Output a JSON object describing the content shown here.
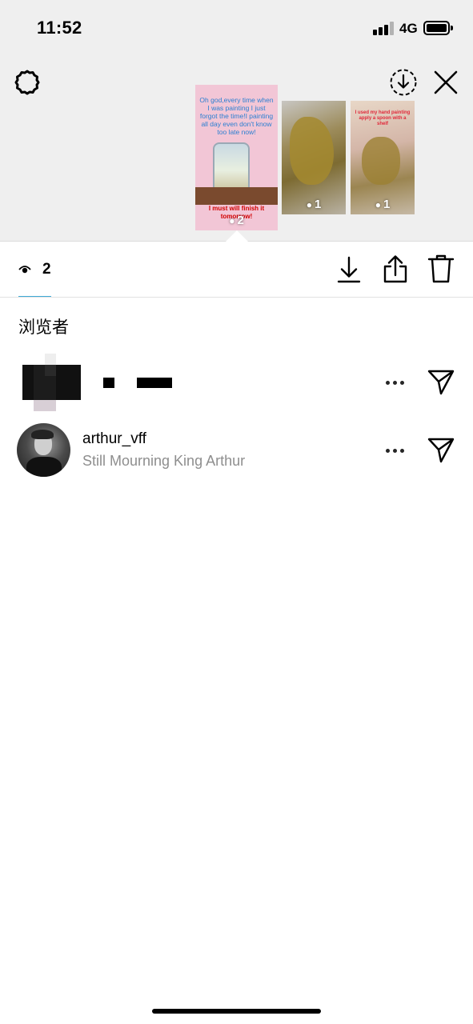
{
  "status": {
    "time": "11:52",
    "network": "4G"
  },
  "header": {
    "settings_icon": "gear-icon",
    "save_icon": "download-circle-icon",
    "close_icon": "close-icon"
  },
  "stories": [
    {
      "views": "2",
      "selected": true,
      "caption_top": "Oh god,every time when I was painting I just forgot the time!I painting all day even don't know too late now!",
      "caption_bottom": "I must will finish it tomorrow!"
    },
    {
      "views": "1",
      "selected": false
    },
    {
      "views": "1",
      "selected": false,
      "caption_top": "I used my hand painting apply a spoon with a shelf"
    }
  ],
  "toolbar": {
    "view_count": "2",
    "download_icon": "download-icon",
    "share_icon": "share-icon",
    "delete_icon": "trash-icon"
  },
  "viewers_title": "浏览者",
  "viewers": [
    {
      "name": "",
      "subtitle": "",
      "redacted": true
    },
    {
      "name": "arthur_vff",
      "subtitle": "Still Mourning King Arthur",
      "redacted": false
    }
  ],
  "colors": {
    "accent_underline": "#3fa9d6",
    "subtitle_gray": "#8e8e8e",
    "story_pink": "#f2c6d6"
  }
}
